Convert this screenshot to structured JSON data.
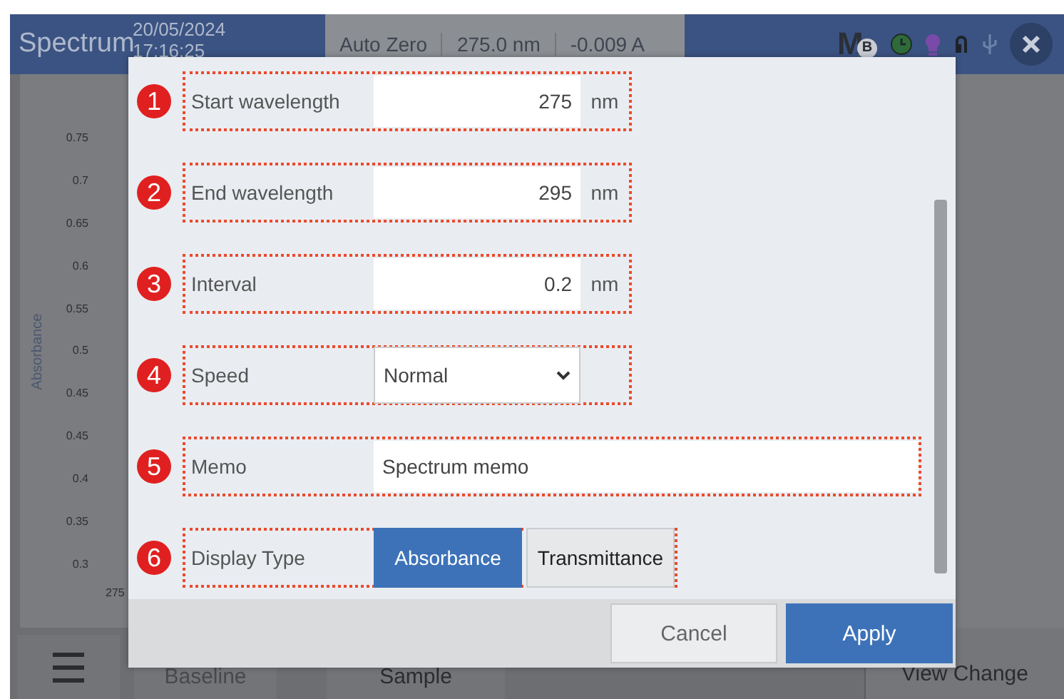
{
  "header": {
    "title": "Spectrum",
    "date": "20/05/2024",
    "time": "17:16:25",
    "status": [
      "Auto Zero",
      "275.0 nm",
      "-0.009 A"
    ],
    "logo": {
      "letter": "M",
      "badge": "B"
    }
  },
  "chart": {
    "ylabel": "Absorbance",
    "y_ticks": [
      "0.75",
      "0.7",
      "0.65",
      "0.6",
      "0.55",
      "0.5",
      "0.45",
      "0.45",
      "0.4",
      "0.35",
      "0.3"
    ],
    "x_ticks": [
      "275"
    ]
  },
  "bottom_bar": {
    "buttons": [
      {
        "label": "Baseline",
        "disabled": true
      },
      {
        "label": "Sample",
        "disabled": false
      },
      {
        "label": "View Change",
        "disabled": false
      }
    ]
  },
  "dialog": {
    "rows": [
      {
        "number": "1",
        "label": "Start wavelength",
        "kind": "number",
        "value": "275",
        "unit": "nm"
      },
      {
        "number": "2",
        "label": "End wavelength",
        "kind": "number",
        "value": "295",
        "unit": "nm"
      },
      {
        "number": "3",
        "label": "Interval",
        "kind": "number",
        "value": "0.2",
        "unit": "nm"
      },
      {
        "number": "4",
        "label": "Speed",
        "kind": "select",
        "value": "Normal"
      },
      {
        "number": "5",
        "label": "Memo",
        "kind": "text",
        "value": "Spectrum memo"
      },
      {
        "number": "6",
        "label": "Display Type",
        "kind": "toggle",
        "options": [
          {
            "label": "Absorbance",
            "selected": true
          },
          {
            "label": "Transmittance",
            "selected": false
          }
        ]
      }
    ],
    "buttons": [
      {
        "label": "Cancel",
        "kind": "secondary"
      },
      {
        "label": "Apply",
        "kind": "primary"
      }
    ]
  }
}
